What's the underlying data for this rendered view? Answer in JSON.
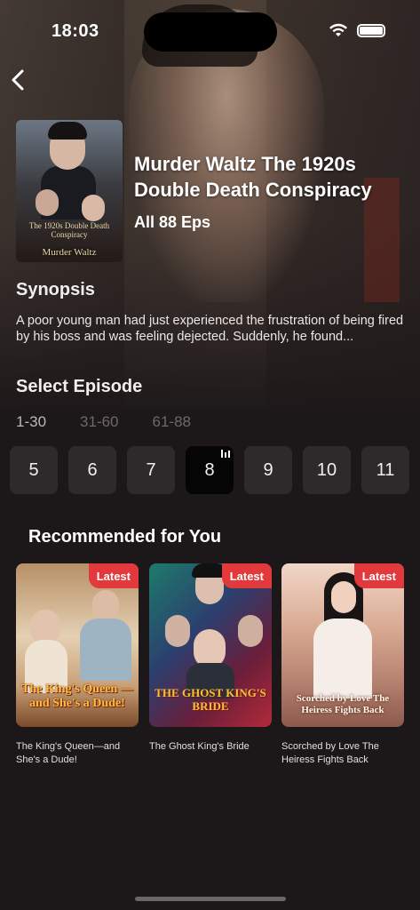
{
  "status_bar": {
    "time": "18:03"
  },
  "show": {
    "title": "Murder Waltz The 1920s Double Death Conspiracy",
    "episodes_label": "All 88 Eps",
    "cover_text_top": "The 1920s Double Death Conspiracy",
    "cover_text_bottom": "Murder Waltz"
  },
  "synopsis": {
    "heading": "Synopsis",
    "text": "A poor young man had just experienced the frustration of being fired by his boss and was feeling dejected. Suddenly, he found..."
  },
  "select_episode": {
    "heading": "Select Episode",
    "ranges": [
      "1-30",
      "31-60",
      "61-88"
    ],
    "active_range": "1-30",
    "episodes": [
      "5",
      "6",
      "7",
      "8",
      "9",
      "10",
      "11"
    ],
    "current_episode": "8"
  },
  "recommended": {
    "heading": "Recommended for You",
    "items": [
      {
        "name": "The King's Queen—and She's a Dude!",
        "badge": "Latest",
        "poster_text": "The King's Queen —and She's a Dude!"
      },
      {
        "name": "The Ghost King's Bride",
        "badge": "Latest",
        "poster_text": "THE GHOST KING'S BRIDE"
      },
      {
        "name": "Scorched by Love The Heiress Fights Back",
        "badge": "Latest",
        "poster_text": "Scorched by Love The Heiress Fights Back"
      }
    ]
  },
  "colors": {
    "badge": "#e23a3c",
    "background": "#1c1718",
    "episode_tile": "#2e2a2b"
  }
}
